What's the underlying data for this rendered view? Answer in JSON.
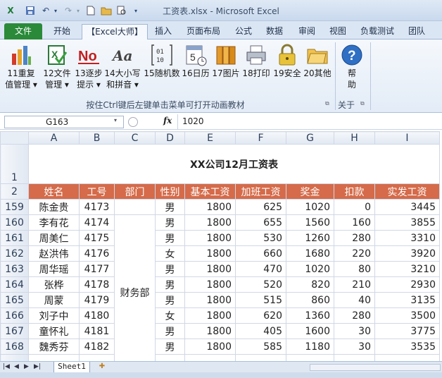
{
  "window": {
    "title": "工资表.xlsx - Microsoft Excel"
  },
  "tabs": [
    {
      "label": "文件"
    },
    {
      "label": "开始"
    },
    {
      "label": "【Excel大师】"
    },
    {
      "label": "插入"
    },
    {
      "label": "页面布局"
    },
    {
      "label": "公式"
    },
    {
      "label": "数据"
    },
    {
      "label": "审阅"
    },
    {
      "label": "视图"
    },
    {
      "label": "负载测试"
    },
    {
      "label": "团队"
    }
  ],
  "ribbon": {
    "buttons": [
      {
        "line1": "11重复",
        "line2": "值管理 ▾",
        "icon": "bar-chart-icon"
      },
      {
        "line1": "12文件",
        "line2": "管理 ▾",
        "icon": "excel-check-icon"
      },
      {
        "line1": "13逐步",
        "line2": "提示 ▾",
        "icon": "no-icon"
      },
      {
        "line1": "14大小写",
        "line2": "和拼音 ▾",
        "icon": "font-case-icon"
      },
      {
        "line1": "15随机数",
        "line2": "",
        "icon": "binary-icon"
      },
      {
        "line1": "16日历",
        "line2": "",
        "icon": "calendar-icon"
      },
      {
        "line1": "17图片",
        "line2": "",
        "icon": "books-icon"
      },
      {
        "line1": "18打印",
        "line2": "",
        "icon": "printer-icon"
      },
      {
        "line1": "19安全",
        "line2": "",
        "icon": "lock-icon"
      },
      {
        "line1": "20其他",
        "line2": "",
        "icon": "folder-icon"
      },
      {
        "line1": "帮",
        "line2": "助",
        "icon": "help-icon"
      }
    ],
    "group_label": "按住Ctrl键后左键单击菜单可打开动画教材",
    "group_label2": "关于"
  },
  "formula": {
    "name_box": "G163",
    "fx": "fx",
    "value": "1020"
  },
  "sheet": {
    "columns": [
      "A",
      "B",
      "C",
      "D",
      "E",
      "F",
      "G",
      "H",
      "I"
    ],
    "title": "XX公司12月工资表",
    "headers": [
      "姓名",
      "工号",
      "部门",
      "性别",
      "基本工资",
      "加班工资",
      "奖金",
      "扣款",
      "实发工资"
    ],
    "rows": [
      {
        "rownum": "159",
        "name": "陈金贵",
        "id": "4173",
        "sex": "男",
        "base": "1800",
        "ot": "625",
        "bonus": "1020",
        "deduct": "0",
        "net": "3445"
      },
      {
        "rownum": "160",
        "name": "李有花",
        "id": "4174",
        "sex": "男",
        "base": "1800",
        "ot": "655",
        "bonus": "1560",
        "deduct": "160",
        "net": "3855"
      },
      {
        "rownum": "161",
        "name": "周美仁",
        "id": "4175",
        "sex": "男",
        "base": "1800",
        "ot": "530",
        "bonus": "1260",
        "deduct": "280",
        "net": "3310"
      },
      {
        "rownum": "162",
        "name": "赵洪伟",
        "id": "4176",
        "sex": "女",
        "base": "1800",
        "ot": "660",
        "bonus": "1680",
        "deduct": "220",
        "net": "3920"
      },
      {
        "rownum": "163",
        "name": "周华瑶",
        "id": "4177",
        "sex": "男",
        "base": "1800",
        "ot": "470",
        "bonus": "1020",
        "deduct": "80",
        "net": "3210"
      },
      {
        "rownum": "164",
        "name": "张桦",
        "id": "4178",
        "sex": "男",
        "base": "1800",
        "ot": "520",
        "bonus": "820",
        "deduct": "210",
        "net": "2930"
      },
      {
        "rownum": "165",
        "name": "周蒙",
        "id": "4179",
        "sex": "男",
        "base": "1800",
        "ot": "515",
        "bonus": "860",
        "deduct": "40",
        "net": "3135"
      },
      {
        "rownum": "166",
        "name": "刘子中",
        "id": "4180",
        "sex": "女",
        "base": "1800",
        "ot": "620",
        "bonus": "1360",
        "deduct": "280",
        "net": "3500"
      },
      {
        "rownum": "167",
        "name": "童怀礼",
        "id": "4181",
        "sex": "男",
        "base": "1800",
        "ot": "405",
        "bonus": "1600",
        "deduct": "30",
        "net": "3775"
      },
      {
        "rownum": "168",
        "name": "魏秀芬",
        "id": "4182",
        "sex": "男",
        "base": "1800",
        "ot": "585",
        "bonus": "1180",
        "deduct": "30",
        "net": "3535"
      }
    ],
    "dept": "财务部",
    "tab_label": "Sheet1"
  }
}
